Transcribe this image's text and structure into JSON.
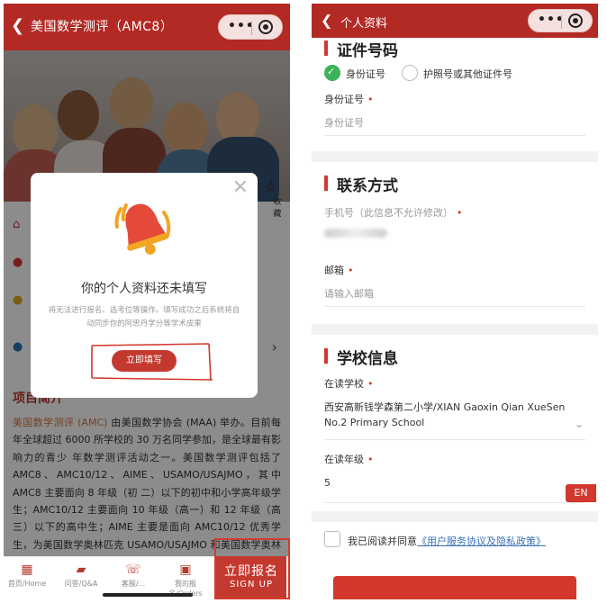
{
  "left": {
    "header": {
      "title": "美国数学测评（AMC8）"
    },
    "star_button": {
      "label": "收藏"
    },
    "section_title": "项目简介",
    "intro": {
      "highlight": "美国数学测评 (AMC)",
      "text": " 由美国数学协会 (MAA) 举办。目前每年全球超过 6000 所学校的 30 万名同学参加，是全球最有影响力的青少 年数学测评活动之一。美国数学测评包括了 AMC8、AMC10/12、AIME、USAMO/USAJMO，其中 AMC8 主要面向 8 年级（初 二）以下的初中和小学高年级学生；AMC10/12 主要面向 10 年级（高一）和 12 年级（高三）以下的高中生；AIME 主要是面向 AMC10/12 优秀学生，为美国数学奥林匹克 USAMO/USAJMO 和美国数学奥林匹克国家队的选拔。"
    },
    "tabs": [
      {
        "label": "首页/Home",
        "icon": "home-icon"
      },
      {
        "label": "问答/Q&A",
        "icon": "chat-icon"
      },
      {
        "label": "客服/...",
        "icon": "phone-icon"
      },
      {
        "label": "我的报名/Orders",
        "icon": "orders-icon"
      }
    ],
    "signup": {
      "cn": "立即报名",
      "en": "SIGN UP"
    },
    "modal": {
      "title": "你的个人资料还未填写",
      "subtitle": "将无法进行报名、选考位等操作。填写成功之后系统将自动同步你的阿思丹学分等学术成果",
      "button": "立即填写",
      "icon": "bell-icon"
    }
  },
  "right": {
    "header": {
      "title": "个人资料"
    },
    "id_section": {
      "title": "证件号码",
      "options": [
        "身份证号",
        "护照号或其他证件号"
      ],
      "selected": "身份证号",
      "label": "身份证号",
      "placeholder": "身份证号"
    },
    "contact": {
      "title": "联系方式",
      "phone_label": "手机号（此信息不允许修改）",
      "email_label": "邮箱",
      "email_placeholder": "请输入邮箱"
    },
    "school": {
      "title": "学校信息",
      "school_label": "在读学校",
      "school_value": "西安高新钱学森第二小学/XIAN Gaoxin Qian XueSen No.2 Primary School",
      "grade_label": "在读年级",
      "grade_value": "5"
    },
    "en_badge": "EN",
    "agreement": {
      "text": "我已阅读并同意",
      "link": "《用户服务协议及隐私政策》"
    }
  }
}
